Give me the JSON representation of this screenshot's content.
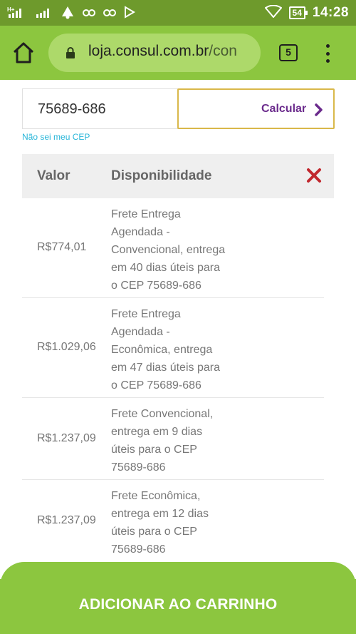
{
  "status_bar": {
    "carrier_labels": [
      "H+",
      "H+"
    ],
    "battery": "54",
    "time": "14:28"
  },
  "browser": {
    "url_domain": "loja.consul.com.br",
    "url_path": "/con",
    "tab_count": "5"
  },
  "cep": {
    "value": "75689-686",
    "calc_label": "Calcular",
    "no_cep_link": "Não sei meu CEP"
  },
  "table": {
    "headers": {
      "valor": "Valor",
      "disponibilidade": "Disponibilidade"
    },
    "rows": [
      {
        "price": "R$774,01",
        "lines": [
          "Frete Entrega",
          "Agendada -",
          "Convencional, entrega",
          "em 40 dias úteis para",
          "o CEP 75689-686"
        ]
      },
      {
        "price": "R$1.029,06",
        "lines": [
          "Frete Entrega",
          "Agendada -",
          "Econômica, entrega",
          "em 47 dias úteis para",
          "o CEP 75689-686"
        ]
      },
      {
        "price": "R$1.237,09",
        "lines": [
          "Frete Convencional,",
          "entrega em 9 dias",
          "úteis para o CEP",
          "75689-686"
        ]
      },
      {
        "price": "R$1.237,09",
        "lines": [
          "Frete Econômica,",
          "entrega em 12 dias",
          "úteis para o CEP",
          "75689-686"
        ]
      }
    ]
  },
  "cart_button_label": "ADICIONAR AO CARRINHO",
  "colors": {
    "status_bar": "#6e9a2c",
    "toolbar": "#8cc63f",
    "calc_text": "#6b2b8c",
    "calc_border": "#d9b84a",
    "close_x": "#c1272d",
    "link": "#29b6d9"
  }
}
